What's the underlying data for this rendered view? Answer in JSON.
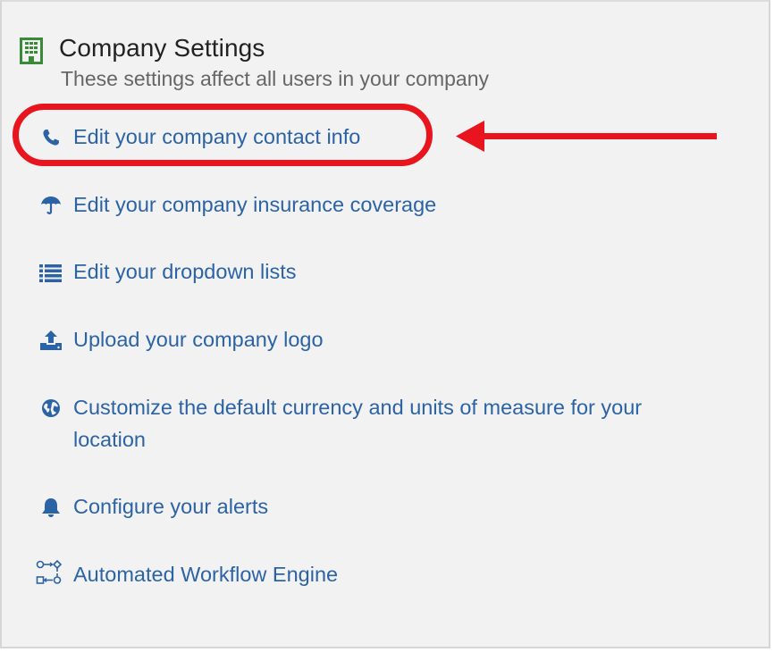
{
  "section": {
    "title": "Company Settings",
    "subtitle": "These settings affect all users in your company",
    "icon": "building-icon"
  },
  "colors": {
    "link": "#2c63a5",
    "title": "#222222",
    "subtitle": "#666666",
    "panel_bg": "#f2f2f2",
    "building_icon": "#3a8a3a",
    "annotation": "#e8141e"
  },
  "links": [
    {
      "label": "Edit your company contact info",
      "icon": "phone-icon"
    },
    {
      "label": "Edit your company insurance coverage",
      "icon": "umbrella-icon"
    },
    {
      "label": "Edit your dropdown lists",
      "icon": "list-icon"
    },
    {
      "label": "Upload your company logo",
      "icon": "upload-icon"
    },
    {
      "label": "Customize the default currency and units of measure for your location",
      "icon": "globe-icon"
    },
    {
      "label": "Configure your alerts",
      "icon": "bell-icon"
    },
    {
      "label": "Automated Workflow Engine",
      "icon": "workflow-icon"
    }
  ],
  "annotation": {
    "highlighted_item": "Edit your company contact info",
    "shapes": [
      "red-ellipse",
      "red-arrow"
    ]
  }
}
